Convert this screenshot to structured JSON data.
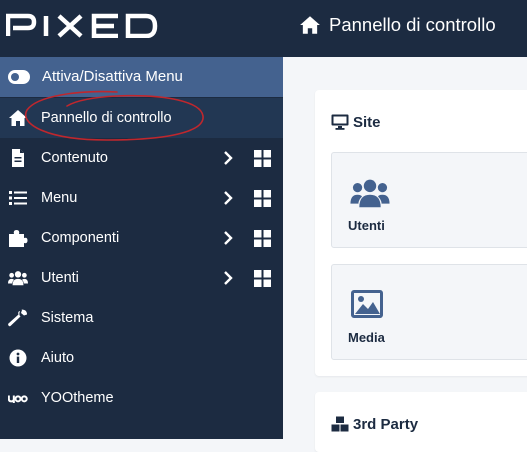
{
  "brand": {
    "logo_text": "PIXED"
  },
  "header": {
    "title": "Pannello di controllo"
  },
  "sidebar": {
    "toggle_label": "Attiva/Disattiva Menu",
    "items": [
      {
        "label": "Pannello di controllo",
        "icon": "home-icon",
        "active": true
      },
      {
        "label": "Contenuto",
        "icon": "file-icon",
        "submenu": true
      },
      {
        "label": "Menu",
        "icon": "list-icon",
        "submenu": true
      },
      {
        "label": "Componenti",
        "icon": "puzzle-icon",
        "submenu": true
      },
      {
        "label": "Utenti",
        "icon": "users-icon",
        "submenu": true
      },
      {
        "label": "Sistema",
        "icon": "wrench-icon"
      },
      {
        "label": "Aiuto",
        "icon": "info-icon"
      },
      {
        "label": "YOOtheme",
        "icon": "yootheme-icon"
      }
    ]
  },
  "main": {
    "site_card": {
      "title": "Site",
      "tiles": [
        {
          "label": "Utenti",
          "icon": "users-icon"
        },
        {
          "label": "Media",
          "icon": "image-icon"
        }
      ]
    },
    "third_party_card": {
      "title": "3rd Party"
    }
  },
  "colors": {
    "sidebar": "#1c2b41",
    "toggle": "#44628f",
    "active_item": "#223753",
    "content_bg": "#f4f6f9",
    "annotation": "#c0272d"
  }
}
